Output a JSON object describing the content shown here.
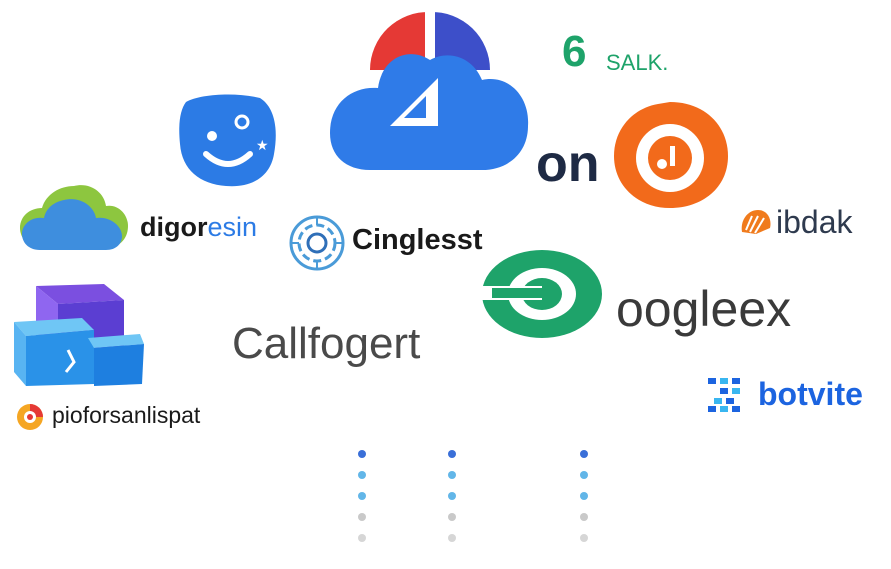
{
  "colors": {
    "google_blue": "#2F7BE8",
    "google_red": "#E53935",
    "google_indigo": "#3D4FC9",
    "green": "#1EA36A",
    "orange": "#F26A1B",
    "navy": "#1E2A44",
    "gray_text": "#4A4A4A",
    "bot_blue": "#1C64E0"
  },
  "logos": {
    "cloud_main": {
      "icon": "multicolor-cloud-icon"
    },
    "on_word": "on",
    "salk": {
      "numeral": "6",
      "word": "SALK."
    },
    "smiley": {
      "icon": "smiley-badge-icon"
    },
    "ibdak": {
      "word": "ibdak",
      "icon": "orange-shell-icon"
    },
    "digoresin": {
      "word_part1": "digor",
      "word_part2": "esin",
      "icon": "cloud-icon"
    },
    "cinglesst": {
      "word": "Cinglesst",
      "icon": "circuit-badge-icon"
    },
    "callfogert": {
      "word": "Callfogert"
    },
    "oogleex": {
      "word": "oogleex",
      "icon": "green-ring-icon"
    },
    "pioforsanlispat": {
      "word": "pioforsanlispat",
      "icon": "orange-pin-icon"
    },
    "cube": {
      "icon": "cube-icon"
    },
    "botvite": {
      "word": "botvite",
      "icon": "pixel-grid-icon"
    },
    "orange_badge": {
      "icon": "orange-music-badge-icon"
    }
  },
  "dot_columns": [
    {
      "colors": [
        "#3A6FD8",
        "#62B6E8",
        "#62B6E8",
        "#C9C9C9",
        "#D6D6D6"
      ]
    },
    {
      "colors": [
        "#3A6FD8",
        "#62B6E8",
        "#62B6E8",
        "#C9C9C9",
        "#D6D6D6"
      ]
    },
    {
      "colors": [
        "#3A6FD8",
        "#62B6E8",
        "#62B6E8",
        "#C9C9C9",
        "#D6D6D6"
      ]
    }
  ]
}
